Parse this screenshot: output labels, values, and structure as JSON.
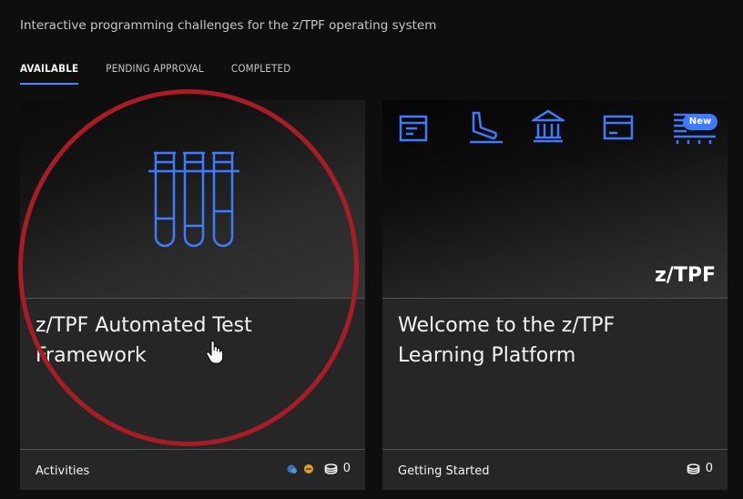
{
  "header": {
    "subtitle": "Interactive programming challenges for the z/TPF operating system"
  },
  "tabs": [
    {
      "label": "AVAILABLE",
      "active": true
    },
    {
      "label": "PENDING APPROVAL",
      "active": false
    },
    {
      "label": "COMPLETED",
      "active": false
    }
  ],
  "cards": [
    {
      "title": "z/TPF Automated Test Framework",
      "hero_icon": "test-tubes-icon",
      "footer_label": "Activities",
      "badge_icons": [
        "blue-badge-icon",
        "gold-badge-icon"
      ],
      "count": "0"
    },
    {
      "title": "Welcome to the z/TPF Learning Platform",
      "logo_text": "z/TPF",
      "hero_icons": [
        "document-icon",
        "airplane-landing-icon",
        "bank-icon",
        "credit-card-icon",
        "new-train-icon"
      ],
      "new_badge": "New",
      "footer_label": "Getting Started",
      "count": "0"
    }
  ],
  "colors": {
    "accent": "#4589ff",
    "icon_blue": "#3f7bff",
    "highlight": "#a81d25",
    "card_bg": "#262626"
  }
}
